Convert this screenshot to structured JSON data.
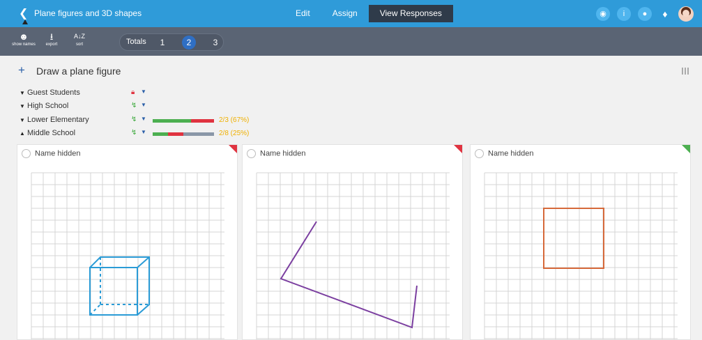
{
  "header": {
    "title": "Plane figures and 3D shapes",
    "tabs": [
      {
        "label": "Edit",
        "active": false
      },
      {
        "label": "Assign",
        "active": false
      },
      {
        "label": "View Responses",
        "active": true
      }
    ],
    "info_badge": "i"
  },
  "toolbar": {
    "show_names": "show names",
    "export": "export",
    "sort": "sort",
    "sort_glyph": "A↓Z",
    "totals_label": "Totals",
    "totals": [
      "1",
      "2",
      "3"
    ],
    "active_total": "2"
  },
  "question": {
    "plus": "+",
    "text": "Draw a plane figure"
  },
  "groups": [
    {
      "name": "Guest Students",
      "expanded": false,
      "icon": "lock-icon",
      "icon_color": "#e03340"
    },
    {
      "name": "High School",
      "expanded": false,
      "icon": "lightning-icon",
      "icon_color": "#3aa83a"
    },
    {
      "name": "Lower Elementary",
      "expanded": false,
      "icon": "lightning-icon",
      "icon_color": "#3aa83a",
      "progress": {
        "green": 0.62,
        "red": 0.38,
        "gray": 0
      },
      "summary": "2/3 (67%)"
    },
    {
      "name": "Middle School",
      "expanded": true,
      "icon": "lightning-icon",
      "icon_color": "#3aa83a",
      "progress": {
        "green": 0.25,
        "red": 0.25,
        "gray": 0.5
      },
      "summary": "2/8 (25%)"
    }
  ],
  "responses": [
    {
      "name": "Name hidden",
      "status_color": "#e03340",
      "shape": "cube",
      "stroke": "#2a9bd6"
    },
    {
      "name": "Name hidden",
      "status_color": "#e03340",
      "shape": "polyline",
      "stroke": "#7b3fa0"
    },
    {
      "name": "Name hidden",
      "status_color": "#4caf50",
      "shape": "square",
      "stroke": "#d6693a"
    }
  ],
  "colors": {
    "topbar": "#2f9bd9",
    "toolbar": "#5a6474",
    "active_tab": "#2f3b4a",
    "progress_green": "#4caf50",
    "progress_red": "#e03340",
    "progress_gray": "#8a97a8",
    "summary_text": "#f0b000"
  }
}
